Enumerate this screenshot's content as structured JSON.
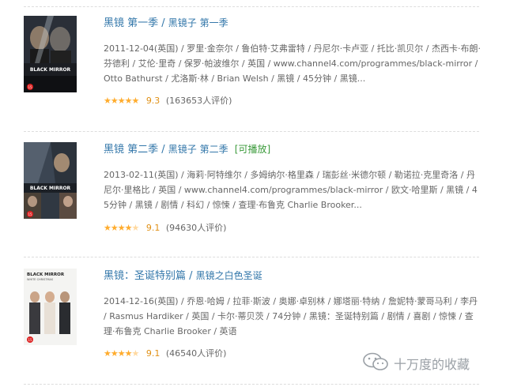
{
  "items": [
    {
      "title": "黑镜 第一季",
      "alt_title": "黑镜子 第一季",
      "playable": "",
      "meta": "2011-12-04(英国) / 罗里·金奈尔 / 鲁伯特·艾弗雷特 / 丹尼尔·卡卢亚 / 托比·凯贝尔 / 杰西卡·布朗·芬德利 / 艾伦·里奇 / 保罗·帕波维尔 / 英国 / www.channel4.com/programmes/black-mirror / Otto Bathurst / 尤洛斯·林 / Brian Welsh / 黑镜 / 45分钟 / 黑镜...",
      "stars": 5,
      "score": "9.3",
      "count": "(163653人评价)",
      "poster_text": "BLACK MIRROR",
      "poster_cert": "15"
    },
    {
      "title": "黑镜 第二季",
      "alt_title": "黑镜子 第二季",
      "playable": "[可播放]",
      "meta": "2013-02-11(英国) / 海莉·阿特维尔 / 多姆纳尔·格里森 / 瑞彭丝·米德尔顿 / 勒诺拉·克里奇洛 / 丹尼尔·里格比 / 英国 / www.channel4.com/programmes/black-mirror / 欧文·哈里斯 / 黑镜 / 45分钟 / 黑镜 / 剧情 / 科幻 / 惊悚 / 查理·布鲁克 Charlie Brooker...",
      "stars": 4.5,
      "score": "9.1",
      "count": "(94630人评价)",
      "poster_text": "BLACK MIRROR",
      "poster_cert": "15"
    },
    {
      "title": "黑镜：圣诞特别篇",
      "alt_title": "黑镜之白色圣诞",
      "playable": "",
      "meta": "2014-12-16(英国) / 乔恩·哈姆 / 拉菲·斯波 / 奥娜·卓别林 / 娜塔丽·特纳 / 詹妮特·蒙哥马利 / 李丹 / Rasmus Hardiker / 英国 / 卡尔·蒂贝茨 / 74分钟 / 黑镜：圣诞特别篇 / 剧情 / 喜剧 / 惊悚 / 查理·布鲁克 Charlie Brooker / 英语",
      "stars": 4.5,
      "score": "9.1",
      "count": "(46540人评价)",
      "poster_text": "BLACK MIRROR",
      "poster_sub": "WHITE CHRISTMAS",
      "poster_cert": "15"
    }
  ],
  "watermark": {
    "text": "十万度的收藏",
    "icon": "wechat-icon"
  },
  "colors": {
    "link": "#3377aa",
    "playable": "#3a9a3a",
    "meta": "#666666",
    "star": "#ffac2d",
    "divider": "#dddddd"
  }
}
